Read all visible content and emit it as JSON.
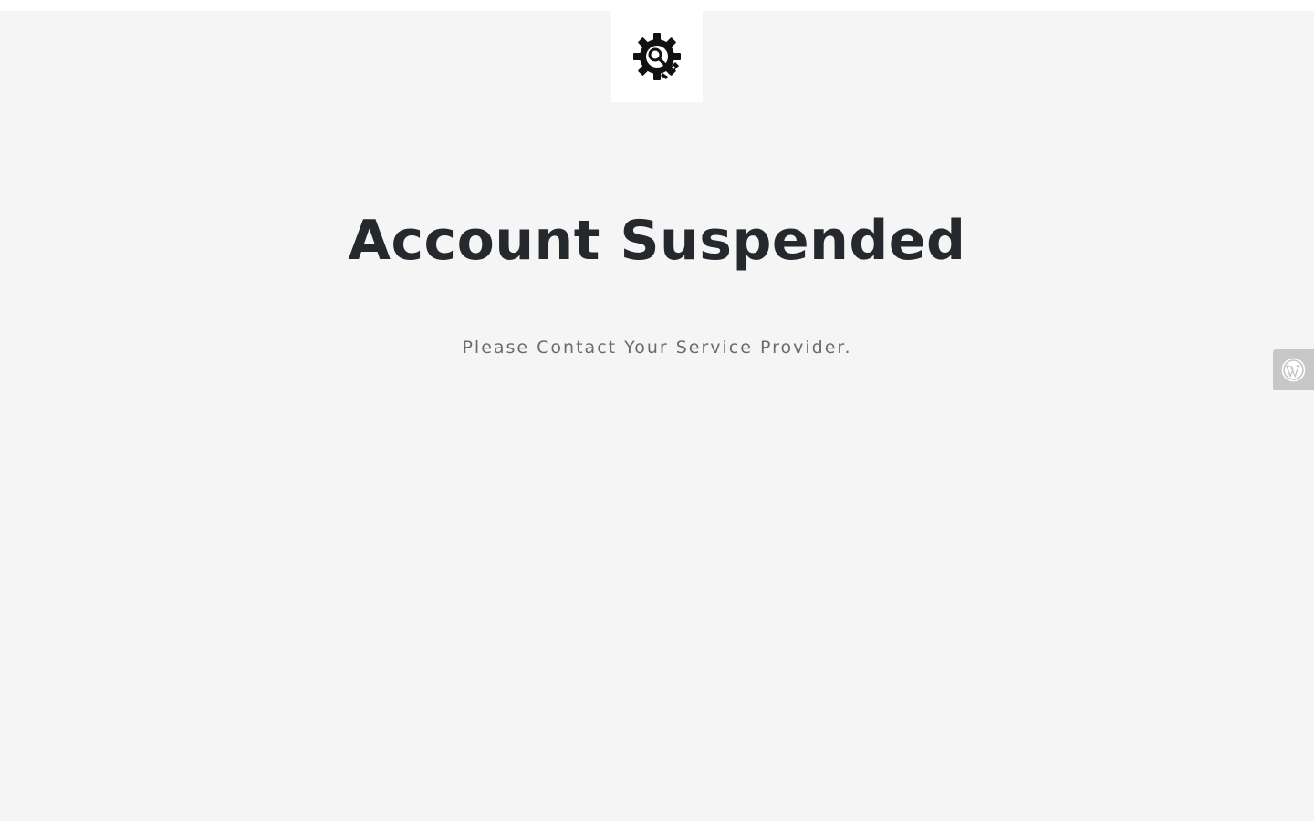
{
  "logo": {
    "icon": "maintenance-gear-icon"
  },
  "main": {
    "title": "Account Suspended",
    "message": "Please Contact Your Service Provider."
  },
  "admin_toggle": {
    "icon": "wordpress-logo-icon"
  },
  "colors": {
    "background": "#f5f5f5",
    "title": "#25282c",
    "message": "#6b6b6b",
    "toggle_bg": "#c7c7c7"
  }
}
